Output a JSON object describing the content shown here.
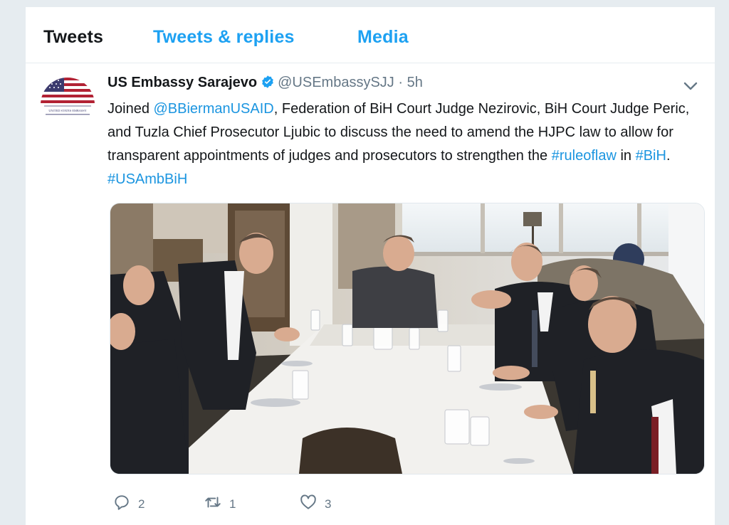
{
  "tabs": [
    {
      "label": "Tweets"
    },
    {
      "label": "Tweets & replies"
    },
    {
      "label": "Media"
    }
  ],
  "tweet": {
    "author_name": "US Embassy Sarajevo",
    "handle": "@USEmbassySJJ",
    "separator": "·",
    "time": "5h",
    "avatar_caption": "UNITED STATES EMBASSY",
    "text_parts": {
      "p1": "Joined ",
      "mention": "@BBiermanUSAID",
      "p2": ", Federation of BiH Court Judge Nezirovic, BiH Court Judge Peric, and Tuzla Chief Prosecutor Ljubic to discuss the need to amend the HJPC law to allow for transparent appointments of judges and prosecutors to strengthen the ",
      "hashtag1": "#ruleoflaw",
      "p3": " in ",
      "hashtag2": "#BiH",
      "p4": ". ",
      "hashtag3": "#USAmbBiH"
    },
    "counts": {
      "replies": "2",
      "retweets": "1",
      "likes": "3"
    }
  },
  "colors": {
    "accent": "#1da1f2",
    "link": "#1b95e0",
    "muted": "#657786",
    "text": "#14171a"
  },
  "icons": [
    "verified-badge-icon",
    "chevron-down-icon",
    "reply-icon",
    "retweet-icon",
    "like-icon"
  ]
}
